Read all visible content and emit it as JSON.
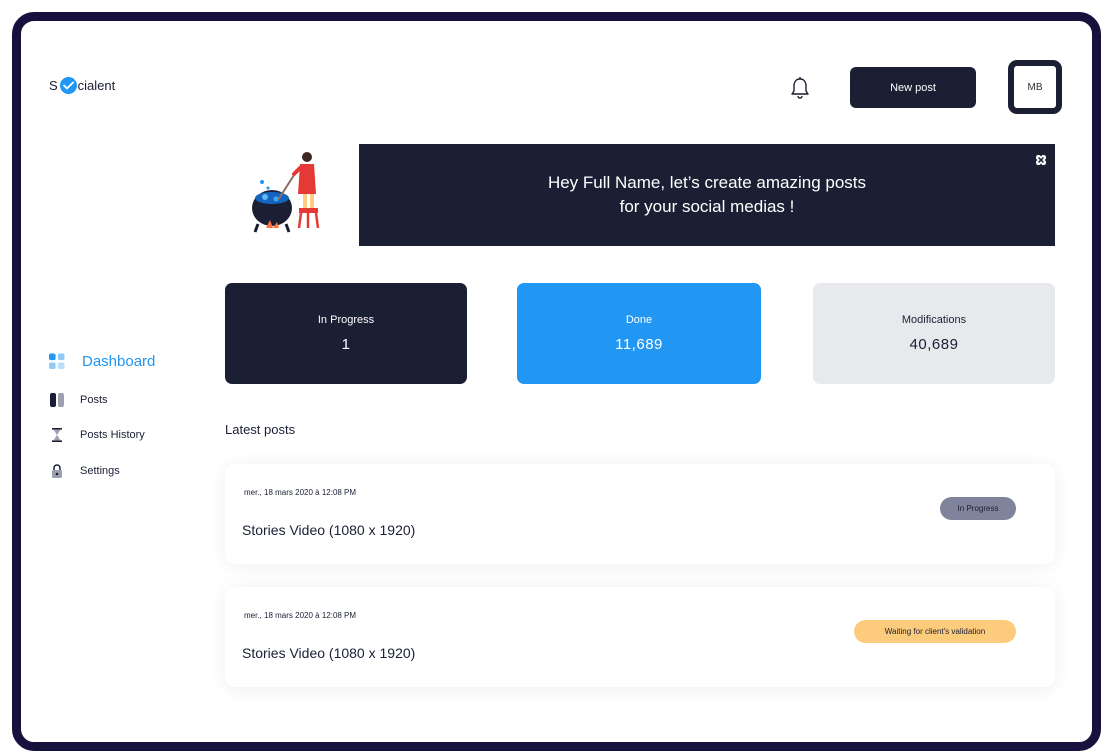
{
  "brand": {
    "prefix": "S",
    "suffix": "cialent",
    "accent": "#2196f3",
    "dark": "#1a1f33"
  },
  "header": {
    "bell_icon": "bell-icon",
    "new_post_label": "New post",
    "avatar_initials": "MB"
  },
  "banner": {
    "line1": "Hey Full Name, let’s create amazing posts",
    "line2": "for your social medias !",
    "close_icon": "close-icon"
  },
  "stats": [
    {
      "label": "In Progress",
      "value": "1",
      "color": "#1a1f33"
    },
    {
      "label": "Done",
      "value": "11,689",
      "color": "#2196f3"
    },
    {
      "label": "Modifications",
      "value": "40,689",
      "color": "#e8e9ec"
    }
  ],
  "sidebar": {
    "items": [
      {
        "label": "Dashboard",
        "icon": "dashboard-icon",
        "active": true
      },
      {
        "label": "Posts",
        "icon": "posts-icon"
      },
      {
        "label": "Posts History",
        "icon": "hourglass-icon"
      },
      {
        "label": "Settings",
        "icon": "lock-icon"
      }
    ]
  },
  "latest": {
    "title": "Latest posts",
    "posts": [
      {
        "date": "mer., 18 mars 2020 à 12:08 PM",
        "title": "Stories Video (1080 x 1920)",
        "status": "In Progress",
        "status_color": "#7f839c"
      },
      {
        "date": "mer., 18 mars 2020 à 12:08 PM",
        "title": "Stories Video (1080 x 1920)",
        "status": "Waiting for client's validation",
        "status_color": "#fdcb7c"
      }
    ]
  }
}
